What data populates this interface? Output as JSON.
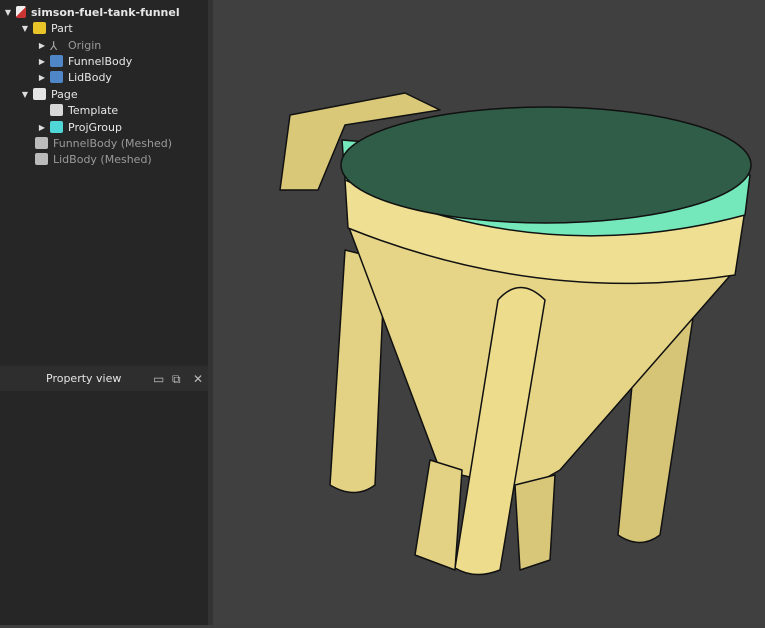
{
  "tree": {
    "root": "simson-fuel-tank-funnel",
    "items": [
      {
        "label": "Part",
        "icon": "part-icon",
        "expanded": true
      },
      {
        "label": "Origin",
        "icon": "origin-icon",
        "dim": true
      },
      {
        "label": "FunnelBody",
        "icon": "body-icon"
      },
      {
        "label": "LidBody",
        "icon": "body-icon"
      },
      {
        "label": "Page",
        "icon": "page-icon",
        "expanded": true
      },
      {
        "label": "Template",
        "icon": "template-icon"
      },
      {
        "label": "ProjGroup",
        "icon": "projgroup-icon"
      },
      {
        "label": "FunnelBody (Meshed)",
        "icon": "mesh-icon",
        "dim": true
      },
      {
        "label": "LidBody (Meshed)",
        "icon": "mesh-icon",
        "dim": true
      }
    ]
  },
  "property_view": {
    "title": "Property view"
  },
  "colors": {
    "body": "#e6d587",
    "lid_top": "#2f5d47",
    "lid_rim": "#74e8bb",
    "viewport": "#404040"
  }
}
